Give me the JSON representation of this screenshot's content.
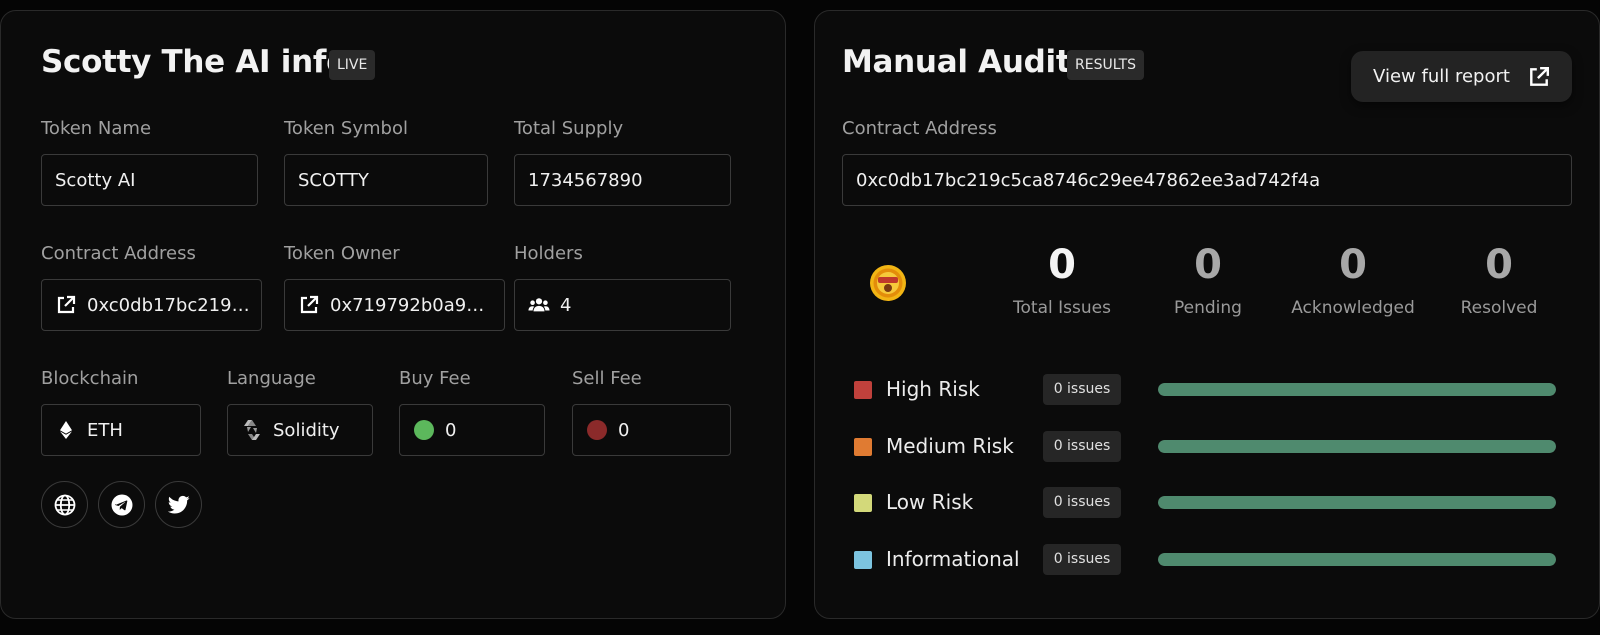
{
  "info": {
    "title": "Scotty The AI info",
    "badge": "LIVE",
    "token_name": {
      "label": "Token Name",
      "value": "Scotty AI"
    },
    "token_symbol": {
      "label": "Token Symbol",
      "value": "SCOTTY"
    },
    "total_supply": {
      "label": "Total Supply",
      "value": "1734567890"
    },
    "contract_address": {
      "label": "Contract Address",
      "value": "0xc0db17bc219c..."
    },
    "token_owner": {
      "label": "Token Owner",
      "value": "0x719792b0a9a6..."
    },
    "holders": {
      "label": "Holders",
      "value": "4"
    },
    "blockchain": {
      "label": "Blockchain",
      "value": "ETH"
    },
    "language": {
      "label": "Language",
      "value": "Solidity"
    },
    "buy_fee": {
      "label": "Buy Fee",
      "value": "0",
      "color": "#5cb85c"
    },
    "sell_fee": {
      "label": "Sell Fee",
      "value": "0",
      "color": "#8b2a2a"
    },
    "socials": [
      "globe-icon",
      "telegram-icon",
      "twitter-icon"
    ]
  },
  "audit": {
    "title": "Manual Audit",
    "badge": "RESULTS",
    "report_button": "View full report",
    "contract_address": {
      "label": "Contract Address",
      "value": "0xc0db17bc219c5ca8746c29ee47862ee3ad742f4a"
    },
    "stats": [
      {
        "value": "0",
        "label": "Total Issues"
      },
      {
        "value": "0",
        "label": "Pending"
      },
      {
        "value": "0",
        "label": "Acknowledged"
      },
      {
        "value": "0",
        "label": "Resolved"
      }
    ],
    "risks": [
      {
        "label": "High Risk",
        "count": "0 issues",
        "color": "#c0413c",
        "bar_fraction": 1.0
      },
      {
        "label": "Medium Risk",
        "count": "0 issues",
        "color": "#e07b32",
        "bar_fraction": 1.0
      },
      {
        "label": "Low Risk",
        "count": "0 issues",
        "color": "#d3d97a",
        "bar_fraction": 1.0
      },
      {
        "label": "Informational",
        "count": "0 issues",
        "color": "#7cc4e0",
        "bar_fraction": 1.0
      }
    ],
    "bar_color": "#4f8a6e"
  }
}
